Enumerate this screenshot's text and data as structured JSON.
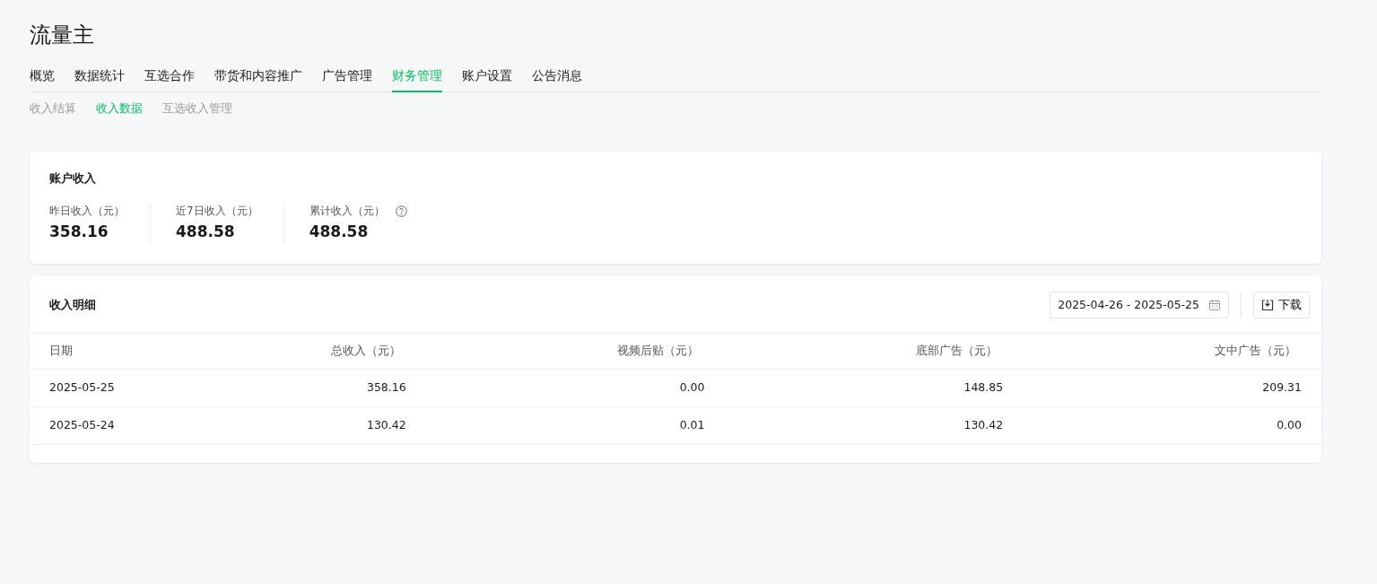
{
  "title": "流量主",
  "tabs": [
    {
      "label": "概览",
      "selected": false
    },
    {
      "label": "数据统计",
      "selected": false
    },
    {
      "label": "互选合作",
      "selected": false
    },
    {
      "label": "带货和内容推广",
      "selected": false
    },
    {
      "label": "广告管理",
      "selected": false
    },
    {
      "label": "财务管理",
      "selected": true
    },
    {
      "label": "账户设置",
      "selected": false
    },
    {
      "label": "公告消息",
      "selected": false
    }
  ],
  "subtabs": [
    {
      "label": "收入结算",
      "selected": false
    },
    {
      "label": "收入数据",
      "selected": true
    },
    {
      "label": "互选收入管理",
      "selected": false
    }
  ],
  "summary": {
    "title": "账户收入",
    "stats": [
      {
        "label": "昨日收入（元）",
        "value": "358.16",
        "help": false
      },
      {
        "label": "近7日收入（元）",
        "value": "488.58",
        "help": false
      },
      {
        "label": "累计收入（元）",
        "value": "488.58",
        "help": true
      }
    ]
  },
  "detail": {
    "title": "收入明细",
    "date_range": "2025-04-26 - 2025-05-25",
    "download": "下载",
    "columns": [
      "日期",
      "总收入（元）",
      "视频后贴（元）",
      "底部广告（元）",
      "文中广告（元）"
    ],
    "rows": [
      [
        "2025-05-25",
        "358.16",
        "0.00",
        "148.85",
        "209.31"
      ],
      [
        "2025-05-24",
        "130.42",
        "0.01",
        "130.42",
        "0.00"
      ]
    ]
  }
}
